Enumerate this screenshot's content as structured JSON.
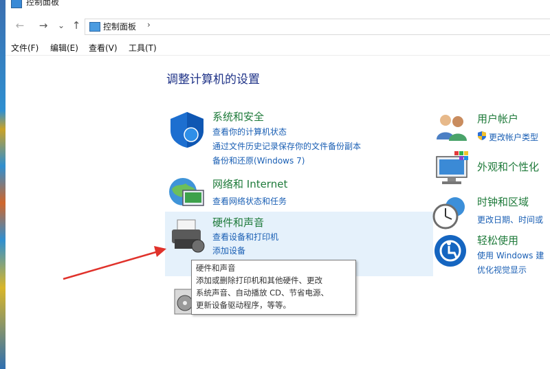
{
  "window": {
    "title": "控制面板"
  },
  "address": {
    "breadcrumb": "控制面板",
    "separator": "›"
  },
  "nav": {
    "back": "←",
    "forward": "→",
    "recent": "⌄",
    "up": "↑"
  },
  "menu": [
    "文件(F)",
    "编辑(E)",
    "查看(V)",
    "工具(T)"
  ],
  "heading": "调整计算机的设置",
  "categories": {
    "system": {
      "title": "系统和安全",
      "links": [
        "查看你的计算机状态",
        "通过文件历史记录保存你的文件备份副本",
        "备份和还原(Windows 7)"
      ],
      "icon": "shield-icon"
    },
    "network": {
      "title": "网络和 Internet",
      "links": [
        "查看网络状态和任务"
      ],
      "icon": "network-globe-icon"
    },
    "hardware": {
      "title": "硬件和声音",
      "links": [
        "查看设备和打印机",
        "添加设备"
      ],
      "icon": "printer-icon"
    },
    "programs": {
      "icon": "programs-disc-icon"
    },
    "users": {
      "title": "用户帐户",
      "links": [
        "更改帐户类型"
      ],
      "icon": "users-icon"
    },
    "appearance": {
      "title": "外观和个性化",
      "icon": "monitor-palette-icon"
    },
    "clock": {
      "title": "时钟和区域",
      "links": [
        "更改日期、时间或"
      ],
      "icon": "clock-globe-icon"
    },
    "ease": {
      "title": "轻松使用",
      "links": [
        "使用 Windows 建",
        "优化视觉显示"
      ],
      "icon": "ease-of-access-icon"
    }
  },
  "tooltip": {
    "title": "硬件和声音",
    "lines": [
      "添加或删除打印机和其他硬件、更改",
      "系统声音、自动播放 CD、节省电源、",
      "更新设备驱动程序，等等。"
    ]
  },
  "colors": {
    "link": "#1a5fb4",
    "category": "#1e7a3a",
    "heading": "#1e3287",
    "hover": "#e5f1fb",
    "arrow": "#e0322b"
  }
}
